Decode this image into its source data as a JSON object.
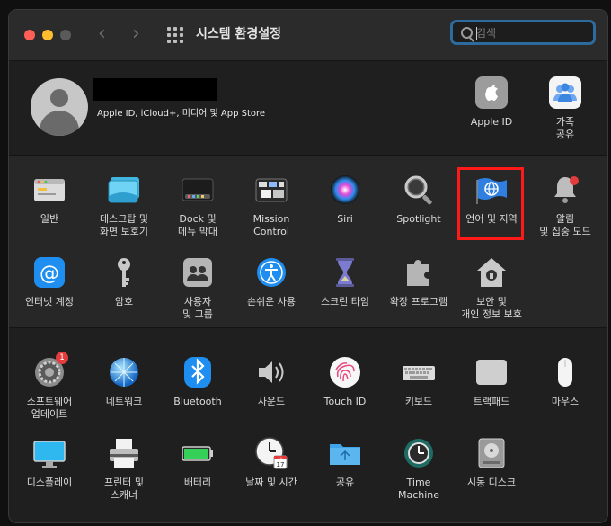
{
  "window": {
    "title": "시스템 환경설정"
  },
  "search": {
    "placeholder": "검색",
    "value": ""
  },
  "account": {
    "subtitle": "Apple ID, iCloud+, 미디어 및 App Store",
    "items": [
      {
        "label": "Apple ID"
      },
      {
        "label_line1": "가족",
        "label_line2": "공유"
      }
    ]
  },
  "row1": [
    {
      "line1": "일반",
      "line2": ""
    },
    {
      "line1": "데스크탑 및",
      "line2": "화면 보호기"
    },
    {
      "line1": "Dock 및",
      "line2": "메뉴 막대"
    },
    {
      "line1": "Mission",
      "line2": "Control"
    },
    {
      "line1": "Siri",
      "line2": ""
    },
    {
      "line1": "Spotlight",
      "line2": ""
    },
    {
      "line1": "언어 및 지역",
      "line2": ""
    },
    {
      "line1": "알림",
      "line2": "및 집중 모드"
    }
  ],
  "row2": [
    {
      "line1": "인터넷 계정",
      "line2": ""
    },
    {
      "line1": "암호",
      "line2": ""
    },
    {
      "line1": "사용자",
      "line2": "및 그룹"
    },
    {
      "line1": "손쉬운 사용",
      "line2": ""
    },
    {
      "line1": "스크린 타임",
      "line2": ""
    },
    {
      "line1": "확장 프로그램",
      "line2": ""
    },
    {
      "line1": "보안 및",
      "line2": "개인 정보 보호"
    }
  ],
  "row3": [
    {
      "line1": "소프트웨어",
      "line2": "업데이트",
      "badge": "1"
    },
    {
      "line1": "네트워크",
      "line2": ""
    },
    {
      "line1": "Bluetooth",
      "line2": ""
    },
    {
      "line1": "사운드",
      "line2": ""
    },
    {
      "line1": "Touch ID",
      "line2": ""
    },
    {
      "line1": "키보드",
      "line2": ""
    },
    {
      "line1": "트랙패드",
      "line2": ""
    },
    {
      "line1": "마우스",
      "line2": ""
    }
  ],
  "row4": [
    {
      "line1": "디스플레이",
      "line2": ""
    },
    {
      "line1": "프린터 및",
      "line2": "스캐너"
    },
    {
      "line1": "배터리",
      "line2": ""
    },
    {
      "line1": "날짜 및 시간",
      "line2": ""
    },
    {
      "line1": "공유",
      "line2": ""
    },
    {
      "line1": "Time",
      "line2": "Machine"
    },
    {
      "line1": "시동 디스크",
      "line2": ""
    }
  ],
  "calendar_icon_date": "17",
  "calendar_icon_month": "JUL",
  "colors": {
    "accent": "#2d6a9e",
    "highlight": "#ff1a1a",
    "badge": "#e43c3c"
  }
}
